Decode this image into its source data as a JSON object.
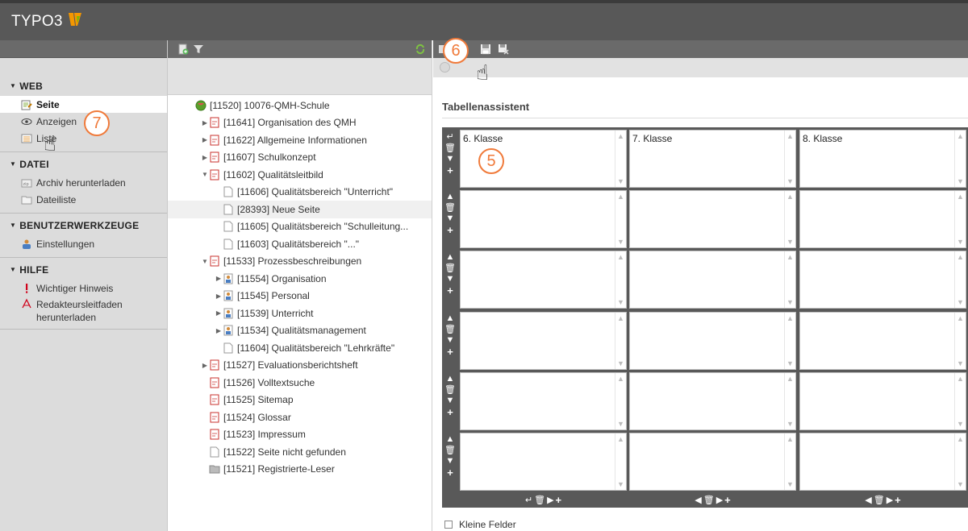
{
  "app": {
    "logo_text": "TYPO3"
  },
  "module_menu": {
    "groups": [
      {
        "title": "WEB",
        "items": [
          {
            "label": "Seite",
            "icon": "page-module-icon",
            "active": true
          },
          {
            "label": "Anzeigen",
            "icon": "eye-icon"
          },
          {
            "label": "Liste",
            "icon": "list-icon"
          }
        ]
      },
      {
        "title": "DATEI",
        "items": [
          {
            "label": "Archiv herunterladen",
            "icon": "archive-icon"
          },
          {
            "label": "Dateiliste",
            "icon": "folder-list-icon"
          }
        ]
      },
      {
        "title": "BENUTZERWERKZEUGE",
        "items": [
          {
            "label": "Einstellungen",
            "icon": "user-settings-icon"
          }
        ]
      },
      {
        "title": "HILFE",
        "items": [
          {
            "label": "Wichtiger Hinweis",
            "icon": "exclamation-icon"
          },
          {
            "label": "Redakteursleitfaden herunterladen",
            "icon": "pdf-icon"
          }
        ]
      }
    ]
  },
  "tree": {
    "nodes": [
      {
        "label": "[11520] 10076-QMH-Schule",
        "icon": "globe-icon",
        "depth": 0,
        "expander": "none"
      },
      {
        "label": "[11641] Organisation des QMH",
        "icon": "shortcut-page-icon",
        "depth": 1,
        "expander": "collapsed"
      },
      {
        "label": "[11622] Allgemeine Informationen",
        "icon": "shortcut-page-icon",
        "depth": 1,
        "expander": "collapsed"
      },
      {
        "label": "[11607] Schulkonzept",
        "icon": "shortcut-page-icon",
        "depth": 1,
        "expander": "collapsed"
      },
      {
        "label": "[11602] Qualitätsleitbild",
        "icon": "shortcut-page-icon",
        "depth": 1,
        "expander": "expanded"
      },
      {
        "label": "[11606] Qualitätsbereich \"Unterricht\"",
        "icon": "page-icon",
        "depth": 2,
        "expander": "none"
      },
      {
        "label": "[28393] Neue Seite",
        "icon": "page-icon",
        "depth": 2,
        "expander": "none",
        "selected": true
      },
      {
        "label": "[11605] Qualitätsbereich \"Schulleitung...",
        "icon": "page-icon",
        "depth": 2,
        "expander": "none"
      },
      {
        "label": "[11603] Qualitätsbereich \"...\"",
        "icon": "page-icon",
        "depth": 2,
        "expander": "none"
      },
      {
        "label": "[11533] Prozessbeschreibungen",
        "icon": "shortcut-page-icon",
        "depth": 1,
        "expander": "expanded"
      },
      {
        "label": "[11554] Organisation",
        "icon": "user-page-icon",
        "depth": 2,
        "expander": "collapsed"
      },
      {
        "label": "[11545] Personal",
        "icon": "user-page-icon",
        "depth": 2,
        "expander": "collapsed"
      },
      {
        "label": "[11539] Unterricht",
        "icon": "user-page-icon",
        "depth": 2,
        "expander": "collapsed"
      },
      {
        "label": "[11534] Qualitätsmanagement",
        "icon": "user-page-icon",
        "depth": 2,
        "expander": "collapsed"
      },
      {
        "label": "[11604] Qualitätsbereich \"Lehrkräfte\"",
        "icon": "page-icon",
        "depth": 2,
        "expander": "none"
      },
      {
        "label": "[11527] Evaluationsberichtsheft",
        "icon": "shortcut-page-icon",
        "depth": 1,
        "expander": "collapsed"
      },
      {
        "label": "[11526] Volltextsuche",
        "icon": "shortcut-page-icon",
        "depth": 1,
        "expander": "none"
      },
      {
        "label": "[11525] Sitemap",
        "icon": "shortcut-page-icon",
        "depth": 1,
        "expander": "none"
      },
      {
        "label": "[11524] Glossar",
        "icon": "shortcut-page-icon",
        "depth": 1,
        "expander": "none"
      },
      {
        "label": "[11523] Impressum",
        "icon": "shortcut-page-icon",
        "depth": 1,
        "expander": "none"
      },
      {
        "label": "[11522] Seite nicht gefunden",
        "icon": "page-icon",
        "depth": 1,
        "expander": "none"
      },
      {
        "label": "[11521] Registrierte-Leser",
        "icon": "folder-icon",
        "depth": 1,
        "expander": "none"
      }
    ]
  },
  "content": {
    "title": "Tabellenassistent",
    "columns": [
      "6. Klasse",
      "7. Klasse",
      "8. Klasse"
    ],
    "row_count": 6,
    "kleine_felder_label": "Kleine Felder",
    "kleine_felder_checked": false
  },
  "callouts": {
    "five": "5",
    "six": "6",
    "seven": "7"
  },
  "colors": {
    "topbar": "#585858",
    "toolbar": "#6a6a6a",
    "accent_orange": "#f07a3a",
    "grid_frame": "#595959"
  }
}
